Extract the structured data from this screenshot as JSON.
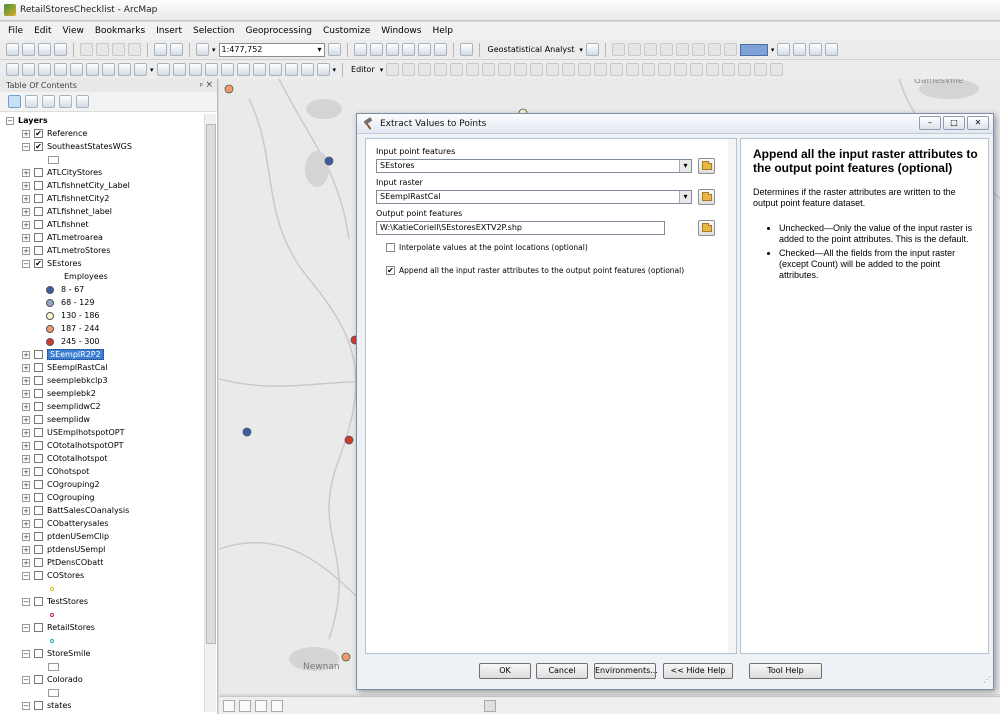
{
  "window": {
    "title": "RetailStoresChecklist - ArcMap"
  },
  "menu": [
    "File",
    "Edit",
    "View",
    "Bookmarks",
    "Insert",
    "Selection",
    "Geoprocessing",
    "Customize",
    "Windows",
    "Help"
  ],
  "toolbar": {
    "scale": "1:477,752",
    "geostatistical_label": "Geostatistical Analyst",
    "editor_label": "Editor"
  },
  "toc": {
    "title": "Table Of Contents",
    "root": "Layers",
    "layers_a": [
      {
        "name": "Reference",
        "checked": "✔"
      },
      {
        "name": "SoutheastStatesWGS",
        "checked": "✔"
      }
    ],
    "layers_b": [
      "ATLCityStores",
      "ATLfishnetCity_Label",
      "ATLfishnetCity2",
      "ATLfishnet_label",
      "ATLfishnet",
      "ATLmetroarea",
      "ATLmetroStores"
    ],
    "sestores": {
      "name": "SEstores",
      "checked": "✔",
      "field": "Employees"
    },
    "classes": [
      {
        "label": "8 - 67",
        "color": "#3b5da8"
      },
      {
        "label": "68 - 129",
        "color": "#8fa6c9"
      },
      {
        "label": "130 - 186",
        "color": "#fbf7cf"
      },
      {
        "label": "187 - 244",
        "color": "#ef9a6a"
      },
      {
        "label": "245 - 300",
        "color": "#d13a2c"
      }
    ],
    "selected_layer": "SEemplR2P2",
    "layers_c": [
      "SEemplRastCal",
      "seemplebkclp3",
      "seemplebk2",
      "seemplidwC2",
      "seemplidw",
      "USEmplhotspotOPT",
      "COtotalhotspotOPT",
      "COtotalhotspot",
      "COhotspot",
      "COgrouping2",
      "COgrouping",
      "BattSalesCOanalysis",
      "CObatterysales",
      "ptdenUSemClip",
      "ptdensUSempl",
      "PtDensCObatt"
    ],
    "layers_d": [
      {
        "name": "COStores",
        "sym": "dot",
        "color": "#e0c020"
      },
      {
        "name": "TestStores",
        "sym": "dot",
        "color": "#c02050"
      },
      {
        "name": "RetailStores",
        "sym": "dot",
        "color": "#20a0a0"
      },
      {
        "name": "StoreSmile",
        "sym": "rect",
        "color": "#ffffff"
      },
      {
        "name": "Colorado",
        "sym": "rect",
        "color": "#ffffff"
      },
      {
        "name": "states",
        "sym": "none",
        "color": ""
      }
    ]
  },
  "map": {
    "labels": [
      "Gainesville",
      "Newnan"
    ],
    "points": [
      {
        "color": "#ef9a6a"
      },
      {
        "color": "#3b5da8"
      },
      {
        "color": "#fbf7cf"
      },
      {
        "color": "#d13a2c"
      },
      {
        "color": "#3b5da8"
      },
      {
        "color": "#d13a2c"
      },
      {
        "color": "#ef9a6a"
      }
    ]
  },
  "dialog": {
    "title": "Extract Values to Points",
    "input_points_label": "Input point features",
    "input_points_value": "SEstores",
    "input_raster_label": "Input raster",
    "input_raster_value": "SEemplRastCal",
    "output_label": "Output point features",
    "output_value": "W:\\KatieCoriell\\SEstoresEXTV2P.shp",
    "interpolate_label": "Interpolate values at the point locations (optional)",
    "interpolate_checked": "",
    "append_label": "Append all the input raster attributes to the output point features (optional)",
    "append_checked": "✔",
    "help_title": "Append all the input raster attributes to the output point features (optional)",
    "help_desc": "Determines if the raster attributes are written to the output point feature dataset.",
    "help_items": [
      "Unchecked—Only the value of the input raster is added to the point attributes. This is the default.",
      "Checked—All the fields from the input raster (except Count) will be added to the point attributes."
    ],
    "buttons": {
      "ok": "OK",
      "cancel": "Cancel",
      "env": "Environments...",
      "hide_help": "<< Hide Help",
      "tool_help": "Tool Help"
    }
  }
}
